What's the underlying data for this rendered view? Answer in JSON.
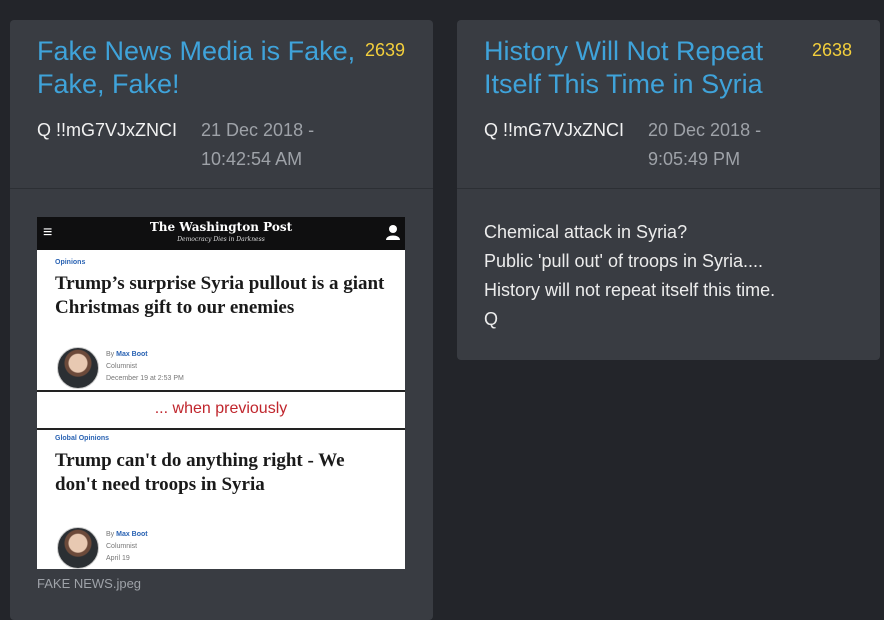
{
  "posts": [
    {
      "title": "Fake News Media is Fake, Fake, Fake!",
      "number": "2639",
      "author": "Q  !!mG7VJxZNCI",
      "date": "21 Dec 2018 - 10:42:54 AM",
      "image": {
        "caption": "FAKE NEWS.jpeg",
        "masthead": "The Washington Post",
        "tagline": "Democracy Dies in Darkness",
        "divider": "... when previously",
        "articles": [
          {
            "section": "Opinions",
            "headline": "Trump’s surprise Syria pullout is a giant Christmas gift to our enemies",
            "by": "By",
            "author": "Max Boot",
            "role": "Columnist",
            "date": "December 19 at 2:53 PM"
          },
          {
            "section": "Global Opinions",
            "headline": "Trump can't do anything right - We don't need troops in Syria",
            "by": "By",
            "author": "Max Boot",
            "role": "Columnist",
            "date": "April 19"
          }
        ]
      }
    },
    {
      "title": "History Will Not Repeat Itself This Time in Syria",
      "number": "2638",
      "author": "Q  !!mG7VJxZNCI",
      "date": "20 Dec 2018 - 9:05:49 PM",
      "body": [
        "Chemical attack in Syria?",
        "Public 'pull out' of troops in Syria....",
        "History will not repeat itself this time.",
        "Q"
      ]
    }
  ],
  "colors": {
    "background": "#23252a",
    "card": "#393c42",
    "title": "#3fa3da",
    "number": "#f3cf3c",
    "date": "#9ea2a8"
  }
}
